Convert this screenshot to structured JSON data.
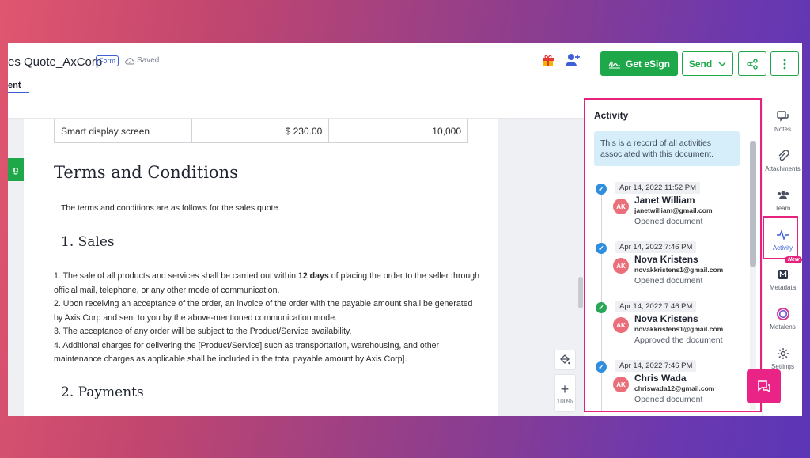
{
  "header": {
    "doc_title": "es Quote_AxCorp",
    "form_badge": "Form",
    "saved_status": "Saved",
    "active_tab": "ent",
    "esign_label": "Get eSign",
    "send_label": "Send"
  },
  "document": {
    "left_tab_label": "g",
    "price_row": [
      "Smart display screen",
      "$ 230.00",
      "10,000"
    ],
    "terms_heading": "Terms and Conditions",
    "terms_intro": "The terms and conditions are as follows for the sales quote.",
    "sales_heading": "1. Sales",
    "clauses": {
      "c1_before": " 1. The sale of all products and services shall be carried out within ",
      "c1_bold": "12 days",
      "c1_after": " of placing the order to the seller through official mail, telephone, or any other mode of communication.",
      "c2": "2. Upon receiving an acceptance of the order, an invoice of the order with the payable amount shall be generated by Axis Corp and sent to you by the above-mentioned communication mode.",
      "c3": "3. The acceptance of any order will be subject to the Product/Service availability.",
      "c4": "4. Additional charges for delivering the [Product/Service] such as transportation, warehousing, and other maintenance charges as applicable shall be included in the total payable amount by Axis Corp]."
    },
    "payments_heading": "2. Payments",
    "zoom_level": "100%"
  },
  "activity": {
    "title": "Activity",
    "info": "This is a record of all activities associated with this document.",
    "entries": [
      {
        "date": "Apr 14, 2022 11:52 PM",
        "initials": "AK",
        "name": "Janet William",
        "email": "janetwilliam@gmail.com",
        "action": "Opened document",
        "status": "blue"
      },
      {
        "date": "Apr 14, 2022 7:46 PM",
        "initials": "AK",
        "name": "Nova Kristens",
        "email": "novakkristens1@gmail.com",
        "action": "Opened document",
        "status": "blue"
      },
      {
        "date": "Apr 14, 2022 7:46 PM",
        "initials": "AK",
        "name": "Nova Kristens",
        "email": "novakkristens1@gmail.com",
        "action": "Approved the document",
        "status": "green"
      },
      {
        "date": "Apr 14, 2022 7:46 PM",
        "initials": "AK",
        "name": "Chris Wada",
        "email": "chriswada12@gmail.com",
        "action": "Opened document",
        "status": "blue"
      }
    ]
  },
  "rail": {
    "notes": "Notes",
    "attachments": "Attachments",
    "team": "Team",
    "activity": "Activity",
    "metadata": "Metadata",
    "metalens": "Metalens",
    "settings": "Settings",
    "new_badge": "New"
  },
  "colors": {
    "accent_green": "#1ea84a",
    "highlight_pink": "#e7217e",
    "link_blue": "#3d5fd9"
  }
}
